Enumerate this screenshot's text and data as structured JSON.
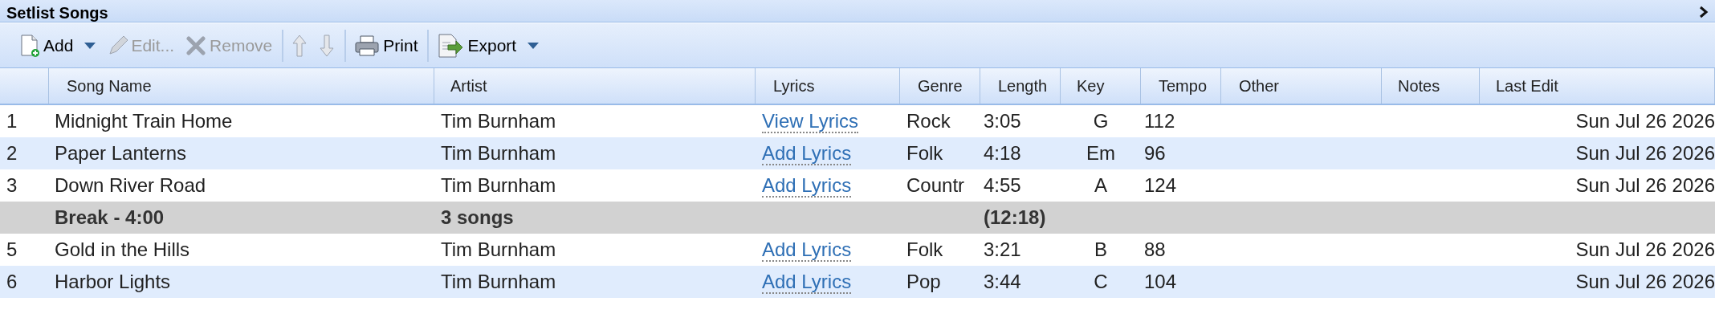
{
  "window": {
    "title": "Setlist Songs"
  },
  "toolbar": [
    {
      "kind": "add",
      "label": "Add",
      "disabled": false,
      "dropdown": true
    },
    {
      "kind": "edit",
      "label": "Edit...",
      "disabled": true,
      "dropdown": false
    },
    {
      "kind": "remove",
      "label": "Remove",
      "disabled": true,
      "dropdown": false,
      "separator_after": true
    },
    {
      "kind": "up",
      "disabled": true,
      "dropdown": false
    },
    {
      "kind": "down",
      "disabled": true,
      "dropdown": false,
      "separator_after": true
    },
    {
      "kind": "print",
      "label": "Print",
      "disabled": false,
      "dropdown": false,
      "separator_after": true
    },
    {
      "kind": "export",
      "label": "Export",
      "disabled": false,
      "dropdown": true
    }
  ],
  "table": {
    "columns": [
      "Song Name",
      "Artist",
      "Lyrics",
      "Genre",
      "Length",
      "Key",
      "Tempo",
      "Other",
      "Notes",
      "Last Edit"
    ],
    "rows": [
      {
        "kind": "song",
        "number": "1",
        "song": "Midnight Train Home",
        "artist": "Tim Burnham",
        "lyrics": "View Lyrics",
        "genre": "Rock",
        "length": "3:05",
        "key": "G",
        "tempo": "112",
        "last_edit": "Sun Jul 26 2026"
      },
      {
        "kind": "song",
        "number": "2",
        "song": "Paper Lanterns",
        "artist": "Tim Burnham",
        "lyrics": "Add Lyrics",
        "genre": "Folk",
        "length": "4:18",
        "key": "Em",
        "tempo": "96",
        "last_edit": "Sun Jul 26 2026"
      },
      {
        "kind": "song",
        "number": "3",
        "song": "Down River Road",
        "artist": "Tim Burnham",
        "lyrics": "Add Lyrics",
        "genre": "Countr",
        "length": "4:55",
        "key": "A",
        "tempo": "124",
        "last_edit": "Sun Jul 26 2026"
      },
      {
        "kind": "break",
        "song": "Break - 4:00",
        "artist": "3 songs",
        "length": "(12:18)"
      },
      {
        "kind": "song",
        "number": "5",
        "song": "Gold in the Hills",
        "artist": "Tim Burnham",
        "lyrics": "Add Lyrics",
        "genre": "Folk",
        "length": "3:21",
        "key": "B",
        "tempo": "88",
        "last_edit": "Sun Jul 26 2026"
      },
      {
        "kind": "song",
        "number": "6",
        "song": "Harbor Lights",
        "artist": "Tim Burnham",
        "lyrics": "Add Lyrics",
        "genre": "Pop",
        "length": "3:44",
        "key": "C",
        "tempo": "104",
        "last_edit": "Sun Jul 26 2026"
      }
    ]
  }
}
